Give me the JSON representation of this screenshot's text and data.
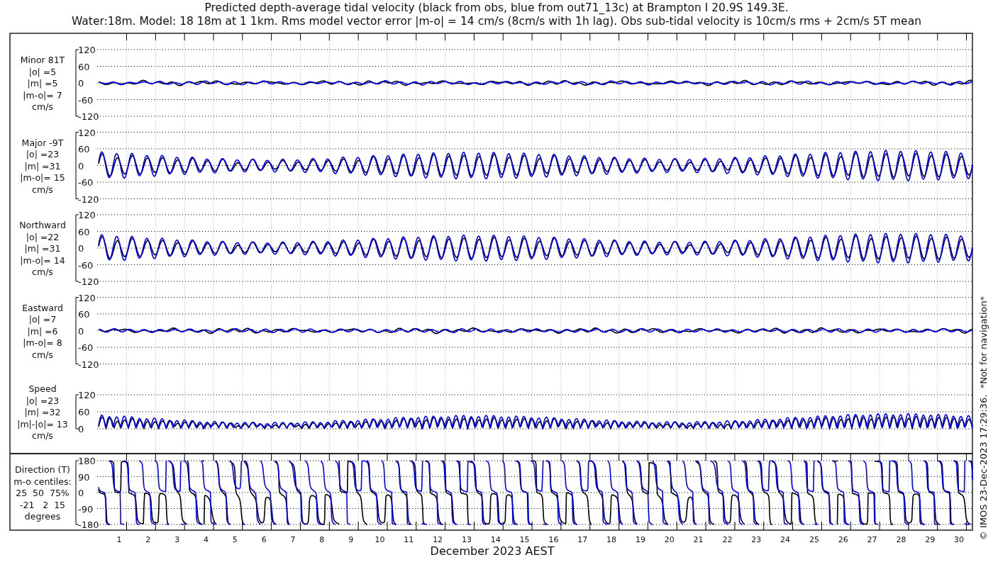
{
  "title_lines": [
    "Predicted depth-average tidal velocity (black from obs, blue from out71_13c) at Brampton I 20.9S 149.3E.",
    "Water:18m. Model: 18 18m at 1 1km. Rms model vector error |m-o| = 14 cm/s (8cm/s with 1h lag). Obs sub-tidal velocity is 10cm/s rms + 2cm/s 5T mean"
  ],
  "panels": [
    {
      "kind": "minor",
      "labels": [
        "Minor 81T",
        "|o| =5",
        "|m| =5",
        "|m-o|= 7",
        "cm/s"
      ],
      "yticks": [
        "120",
        "60",
        "0",
        "-60",
        "-120"
      ]
    },
    {
      "kind": "major",
      "labels": [
        "Major -9T",
        "|o| =23",
        "|m| =31",
        "|m-o|= 15",
        "cm/s"
      ],
      "yticks": [
        "120",
        "60",
        "0",
        "-60",
        "-120"
      ]
    },
    {
      "kind": "northward",
      "labels": [
        "Northward",
        "|o| =22",
        "|m| =31",
        "|m-o|= 14",
        "cm/s"
      ],
      "yticks": [
        "120",
        "60",
        "0",
        "-60",
        "-120"
      ]
    },
    {
      "kind": "eastward",
      "labels": [
        "Eastward",
        "|o| =7",
        "|m| =6",
        "|m-o|= 8",
        "cm/s"
      ],
      "yticks": [
        "120",
        "60",
        "0",
        "-60",
        "-120"
      ]
    },
    {
      "kind": "speed",
      "labels": [
        "Speed",
        "|o| =23",
        "|m| =32",
        "|m|-|o|= 13",
        "cm/s"
      ],
      "yticks": [
        "120",
        "60",
        "0"
      ]
    },
    {
      "kind": "direction",
      "labels": [
        "Direction (T)",
        "m-o centiles:",
        "25  50  75%",
        "-21   2  15",
        "degrees"
      ],
      "yticks": [
        "180",
        "90",
        "0",
        "-90",
        "-180"
      ]
    }
  ],
  "x_axis": {
    "day_labels": [
      "1",
      "2",
      "3",
      "4",
      "5",
      "6",
      "7",
      "8",
      "9",
      "10",
      "11",
      "12",
      "13",
      "14",
      "15",
      "16",
      "17",
      "18",
      "19",
      "20",
      "21",
      "22",
      "23",
      "24",
      "25",
      "26",
      "27",
      "28",
      "29",
      "30"
    ],
    "label": "December 2023 AEST"
  },
  "side_note": "© IMOS 23-Dec-2023 17:29:36.  *Not for navigation*"
}
